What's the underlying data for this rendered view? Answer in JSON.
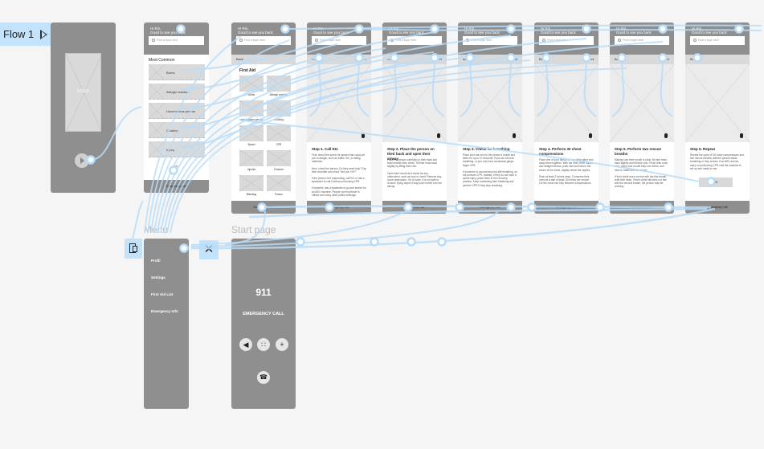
{
  "flow": {
    "label": "Flow 1",
    "icon": "play-outline-icon"
  },
  "splash": {
    "logo_text": "LOGO"
  },
  "common": {
    "greeting": "Hi Rin,",
    "sub_greeting": "Good to see you back",
    "search_placeholder": "Find a topic here",
    "back": "Back",
    "next": "Next",
    "footer": "Emergency Call"
  },
  "home": {
    "section_title": "Most Common",
    "items": [
      "Burns",
      "Allergic reaction",
      "Unconscious person",
      "Choking",
      "Injury"
    ],
    "pager": "1 2"
  },
  "first_aid": {
    "title": "First Aid",
    "items": [
      "Burns",
      "Allergic reaction",
      "Unconscious person",
      "Choking",
      "Sprain",
      "CPR",
      "Injuries",
      "Fracture",
      "Bleeding",
      "Poison"
    ]
  },
  "steps": [
    {
      "title": "Step 1. Call 911",
      "body": [
        "First, check the scene for factors that could put you in danger, such as traffic, fire, or falling materials.",
        "Next, check the person. Do they need help? Tap their shoulder and shout \"Are you OK?\"",
        "If the person isn't responding, call 911 or ask a bystander to call it before performing CPR.",
        "If possible, ask a bystander to go and search for an AED machine. People can find these in offices and many other public buildings."
      ]
    },
    {
      "title": "Step 2. Place the person on their back and open their airway",
      "body": [
        "Place the person carefully on their back and kneel beside their chest. Tilt their head back slightly by lifting their chin.",
        "Open their mouth and check for any obstruction, such as food or vomit. Remove any loose obstruction. If it is loose, it is not safe to remove, flying object it may push further into the airway."
      ]
    },
    {
      "title": "Step 3. Check for breathing",
      "body": [
        "Place your ear next to the person's mouth and listen for up to 10 seconds. If you do not hear breathing, or you only hear occasional gasps, begin CPR.",
        "If someone is unconscious but still breathing, do not perform CPR. Instead, if they do not have a spinal injury, place them in the recovery position. Keep monitoring their breathing and perform CPR if they stop breathing."
      ]
    },
    {
      "title": "Step 4. Perform 30 chest compressions",
      "body": [
        "Place one of your hands on top of the other and clasp them together. With the heel of the hands and straight elbows, push hard and fast in the center of the chest, slightly below the nipples.",
        "Push at least 2 inches deep. Compress their chest at a rate of least 100 times per minute. Let the chest rise fully between compressions."
      ]
    },
    {
      "title": "Step 5. Perform two rescue breaths",
      "body": [
        "Making sure their mouth is clear, tilt their head back slightly and lift their chin. Pinch their nose shut, place your mouth fully over theirs, and blow to make their chest rise.",
        "If their chest does not rise with the first breath, retilt their head. If their chest still does not rise with the second breath, the person may be choking."
      ]
    },
    {
      "title": "Step 6. Repeat",
      "body": [
        "Repeat the cycle of 30 chest compressions and two rescue breaths until the person starts breathing or help arrives. If an AED arrives, carry on performing CPR until the machine is set up and ready to use."
      ],
      "ok": "OK"
    }
  ],
  "menu": {
    "label": "Menu",
    "items": [
      "Profil",
      "Settings",
      "First Aid List",
      "Emergency Info"
    ]
  },
  "call": {
    "label": "Start page",
    "number": "911",
    "title": "EMERGENCY CALL",
    "buttons": [
      {
        "name": "speaker",
        "glyph": "◀"
      },
      {
        "name": "keypad",
        "glyph": "∷"
      },
      {
        "name": "add",
        "glyph": "+"
      }
    ],
    "hangup_glyph": "☎"
  },
  "colors": {
    "canvas": "#f5f5f5",
    "frame_dark": "#8f8f8f",
    "frame_light": "#d9d9d9",
    "link": "#b8dcf8",
    "tag": "#c2e3fb"
  }
}
